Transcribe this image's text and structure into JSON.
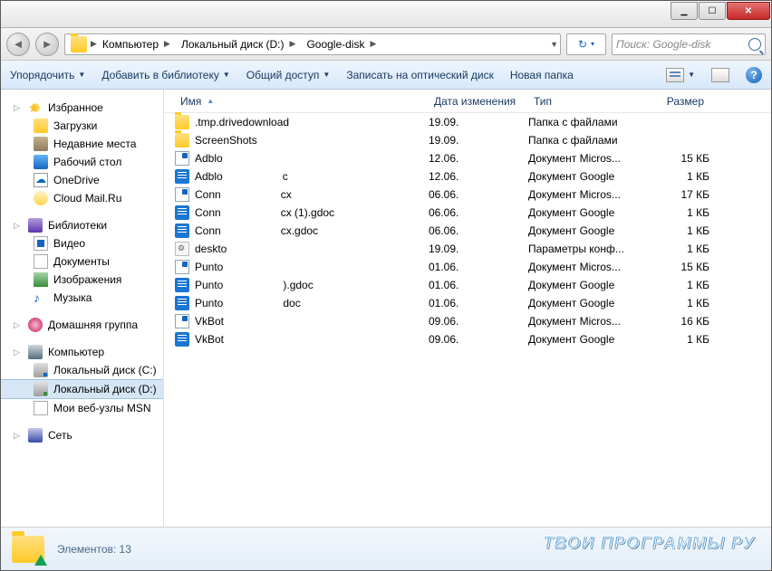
{
  "breadcrumb": {
    "segments": [
      "Компьютер",
      "Локальный диск (D:)",
      "Google-disk"
    ]
  },
  "search": {
    "placeholder": "Поиск: Google-disk"
  },
  "toolbar": {
    "organize": "Упорядочить",
    "add_library": "Добавить в библиотеку",
    "share": "Общий доступ",
    "burn": "Записать на оптический диск",
    "new_folder": "Новая папка",
    "help_char": "?"
  },
  "columns": {
    "name": "Имя",
    "date": "Дата изменения",
    "type": "Тип",
    "size": "Размер"
  },
  "sidebar": {
    "favorites": "Избранное",
    "fav_items": [
      "Загрузки",
      "Недавние места",
      "Рабочий стол",
      "OneDrive",
      "Cloud Mail.Ru"
    ],
    "libraries": "Библиотеки",
    "lib_items": [
      "Видео",
      "Документы",
      "Изображения",
      "Музыка"
    ],
    "homegroup": "Домашняя группа",
    "computer": "Компьютер",
    "comp_items": [
      "Локальный диск (C:)",
      "Локальный диск (D:)",
      "Мои веб-узлы MSN"
    ],
    "network": "Сеть"
  },
  "files": [
    {
      "ico": "folder",
      "name1": ".tmp.drivedownload",
      "name2": "",
      "date": "19.09.",
      "type": "Папка с файлами",
      "size": ""
    },
    {
      "ico": "folder",
      "name1": "ScreenShots",
      "name2": "",
      "date": "19.09.",
      "type": "Папка с файлами",
      "size": ""
    },
    {
      "ico": "word",
      "name1": "Adblo",
      "name2": "",
      "date": "12.06.",
      "type": "Документ Micros...",
      "size": "15 КБ"
    },
    {
      "ico": "gdoc",
      "name1": "Adblo",
      "name2": "c",
      "date": "12.06.",
      "type": "Документ Google",
      "size": "1 КБ"
    },
    {
      "ico": "word",
      "name1": "Conn",
      "name2": "cx",
      "date": "06.06.",
      "type": "Документ Micros...",
      "size": "17 КБ"
    },
    {
      "ico": "gdoc",
      "name1": "Conn",
      "name2": "cx (1).gdoc",
      "date": "06.06.",
      "type": "Документ Google",
      "size": "1 КБ"
    },
    {
      "ico": "gdoc",
      "name1": "Conn",
      "name2": "cx.gdoc",
      "date": "06.06.",
      "type": "Документ Google",
      "size": "1 КБ"
    },
    {
      "ico": "ini",
      "name1": "deskto",
      "name2": "",
      "date": "19.09.",
      "type": "Параметры конф...",
      "size": "1 КБ"
    },
    {
      "ico": "word",
      "name1": "Punto",
      "name2": "",
      "date": "01.06.",
      "type": "Документ Micros...",
      "size": "15 КБ"
    },
    {
      "ico": "gdoc",
      "name1": "Punto",
      "name2": ").gdoc",
      "date": "01.06.",
      "type": "Документ Google",
      "size": "1 КБ"
    },
    {
      "ico": "gdoc",
      "name1": "Punto",
      "name2": "doc",
      "date": "01.06.",
      "type": "Документ Google",
      "size": "1 КБ"
    },
    {
      "ico": "word",
      "name1": "VkBot",
      "name2": "",
      "date": "09.06.",
      "type": "Документ Micros...",
      "size": "16 КБ"
    },
    {
      "ico": "gdoc",
      "name1": "VkBot",
      "name2": "",
      "date": "09.06.",
      "type": "Документ Google",
      "size": "1 КБ"
    }
  ],
  "status": {
    "label": "Элементов:",
    "count": "13"
  },
  "watermark": "ТВОИ ПРОГРАММЫ РУ"
}
